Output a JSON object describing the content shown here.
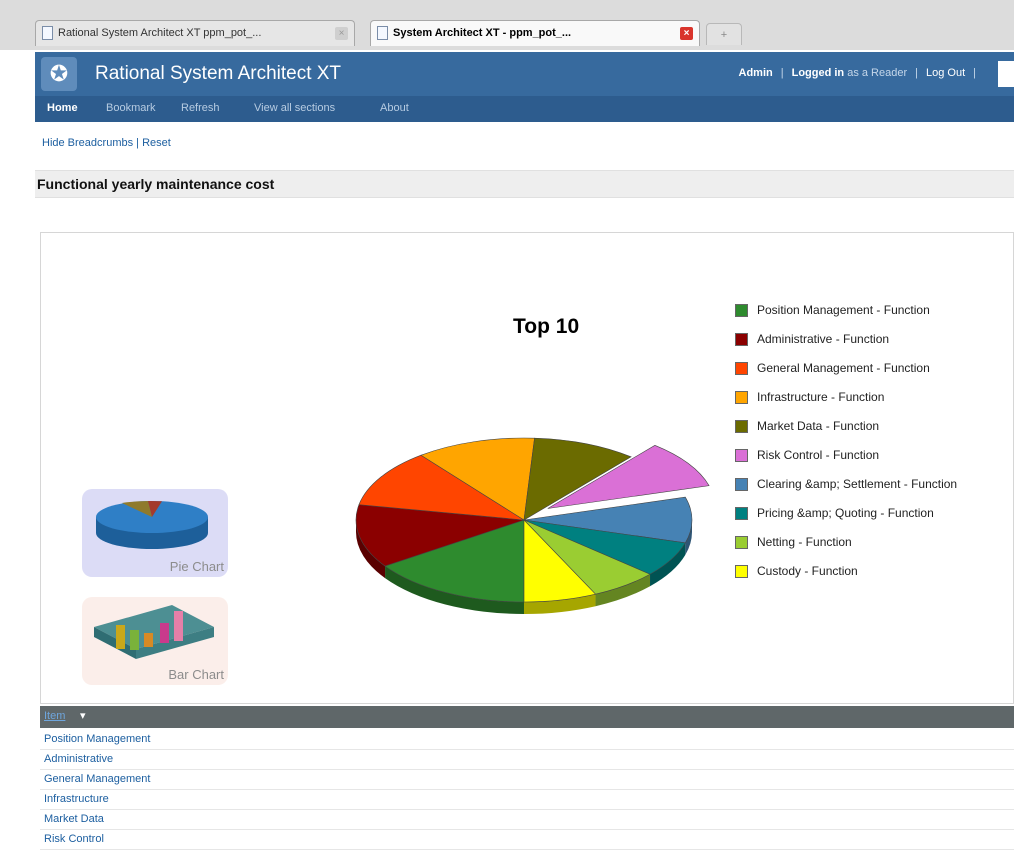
{
  "browser": {
    "tabs": [
      {
        "title": "Rational System Architect XT ppm_pot_..."
      },
      {
        "title": "System Architect XT - ppm_pot_..."
      }
    ],
    "new_tab_symbol": "+",
    "close_symbol": "×"
  },
  "app": {
    "title": "Rational System Architect XT",
    "user_link": "Admin",
    "logged_in_prefix": "Logged in",
    "logged_in_suffix": "as a Reader",
    "logout": "Log Out",
    "separator": "|",
    "logo_icon": "✪"
  },
  "nav": {
    "items": [
      "Home",
      "Bookmark",
      "Refresh",
      "View all sections",
      "About"
    ]
  },
  "breadcrumbs": {
    "hide": "Hide Breadcrumbs",
    "sep": "|",
    "reset": "Reset"
  },
  "page": {
    "title": "Functional yearly maintenance cost"
  },
  "chart_data": {
    "type": "pie",
    "title": "Top 10",
    "exploded_slice": "Risk Control - Function",
    "series": [
      {
        "label": "Position Management - Function",
        "value": 15.5,
        "color": "#2e8b2e"
      },
      {
        "label": "Administrative - Function",
        "value": 12.5,
        "color": "#8b0000"
      },
      {
        "label": "General Management - Function",
        "value": 11.5,
        "color": "#ff4500"
      },
      {
        "label": "Infrastructure - Function",
        "value": 11.5,
        "color": "#ffa500"
      },
      {
        "label": "Market Data - Function",
        "value": 10,
        "color": "#6b6b00"
      },
      {
        "label": "Risk Control - Function",
        "value": 9.5,
        "color": "#da70d6"
      },
      {
        "label": "Clearing &amp; Settlement - Function",
        "value": 9,
        "color": "#4682b4"
      },
      {
        "label": "Pricing &amp; Quoting - Function",
        "value": 7,
        "color": "#008080"
      },
      {
        "label": "Netting - Function",
        "value": 6.5,
        "color": "#9acd32"
      },
      {
        "label": "Custody - Function",
        "value": 7,
        "color": "#ffff00"
      }
    ]
  },
  "thumbs": {
    "pie": "Pie Chart",
    "bar": "Bar Chart"
  },
  "table": {
    "header": "Item",
    "sort_symbol": "▾",
    "rows": [
      "Position Management",
      "Administrative",
      "General Management",
      "Infrastructure",
      "Market Data",
      "Risk Control"
    ]
  }
}
